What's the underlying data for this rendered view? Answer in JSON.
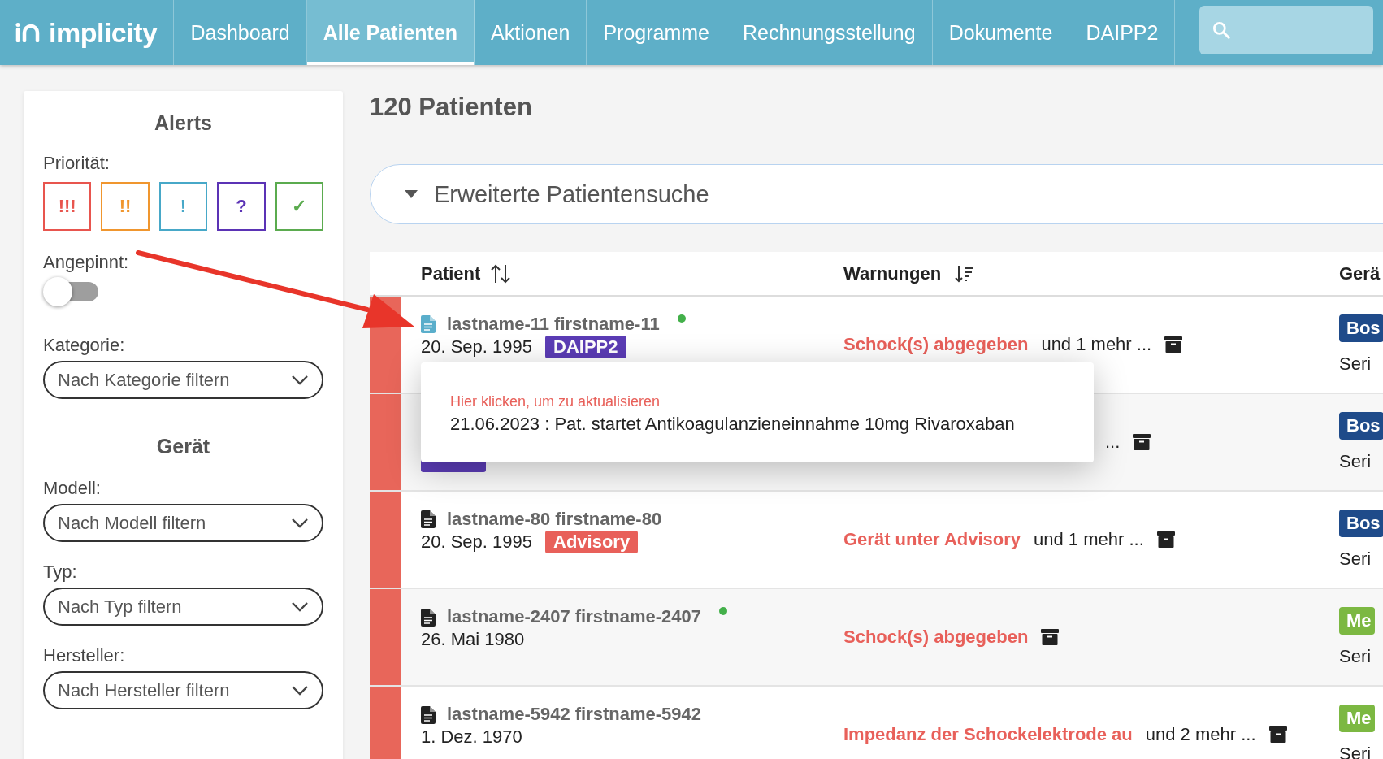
{
  "nav": {
    "logo": "implicity",
    "tabs": [
      {
        "label": "Dashboard",
        "selected": false
      },
      {
        "label": "Alle Patienten",
        "selected": true
      },
      {
        "label": "Aktionen",
        "selected": false
      },
      {
        "label": "Programme",
        "selected": false
      },
      {
        "label": "Rechnungsstellung",
        "selected": false
      },
      {
        "label": "Dokumente",
        "selected": false
      },
      {
        "label": "DAIPP2",
        "selected": false
      }
    ]
  },
  "filters": {
    "alerts_title": "Alerts",
    "priority_label": "Priorität:",
    "priorities": [
      {
        "symbol": "!!!",
        "color": "#e8554e",
        "selected": false
      },
      {
        "symbol": "!!",
        "color": "#f0962e",
        "selected": false
      },
      {
        "symbol": "!",
        "color": "#47a8c8",
        "selected": false
      },
      {
        "symbol": "?",
        "color": "#5b33b5",
        "selected": false
      },
      {
        "symbol": "✓",
        "color": "#5bab4f",
        "selected": false
      }
    ],
    "pinned_label": "Angepinnt:",
    "pinned": false,
    "category": {
      "label": "Kategorie:",
      "placeholder": "Nach Kategorie filtern"
    },
    "device_title": "Gerät",
    "device_filters": [
      {
        "label": "Modell:",
        "placeholder": "Nach Modell filtern"
      },
      {
        "label": "Typ:",
        "placeholder": "Nach Typ filtern"
      },
      {
        "label": "Hersteller:",
        "placeholder": "Nach Hersteller filtern"
      }
    ]
  },
  "main": {
    "title": "120 Patienten",
    "advanced_search": {
      "label": "Erweiterte Patientensuche",
      "expanded": false
    },
    "table": {
      "columns": [
        {
          "label": "Patient",
          "kind": "sortable"
        },
        {
          "label": "Warnungen",
          "kind": "sorted"
        },
        {
          "label": "Gerä",
          "kind": "plain"
        }
      ],
      "rows": [
        {
          "color": "#e8665a",
          "name": "lastname-11 firstname-11",
          "note_active": true,
          "online": true,
          "date": "20. Sep. 1995",
          "tag": {
            "label": "DAIPP2",
            "color": "#5b3cb5"
          },
          "warning": "Schock(s) abgegeben",
          "more": "und 1 mehr ...",
          "device_tag": {
            "label": "Bos",
            "color": "#1f4b8a"
          },
          "device_line": "Seri"
        },
        {
          "color": "#e8665a",
          "tag": {
            "color": "#5b3cb5"
          },
          "more": "...",
          "device_tag": {
            "label": "Bos",
            "color": "#1f4b8a"
          },
          "device_line": "Seri"
        },
        {
          "color": "#e8665a",
          "name": "lastname-80 firstname-80",
          "note_active": false,
          "online": false,
          "date": "20. Sep. 1995",
          "tag": {
            "label": "Advisory",
            "color": "#e8605a"
          },
          "warning": "Gerät unter Advisory",
          "more": "und 1 mehr ...",
          "device_tag": {
            "label": "Bos",
            "color": "#1f4b8a"
          },
          "device_line": "Seri"
        },
        {
          "color": "#e8665a",
          "name": "lastname-2407 firstname-2407",
          "note_active": false,
          "online": true,
          "date": "26. Mai 1980",
          "warning": "Schock(s) abgegeben",
          "device_tag": {
            "label": "Me",
            "color": "#7cb842"
          },
          "device_line": "Seri"
        },
        {
          "color": "#e8665a",
          "name": "lastname-5942 firstname-5942",
          "note_active": false,
          "online": false,
          "date": "1. Dez. 1970",
          "warning": "Impedanz der Schockelektrode au",
          "more": "und 2 mehr ...",
          "device_tag": {
            "label": "Me",
            "color": "#7cb842"
          },
          "device_line": "Seri"
        }
      ]
    },
    "tooltip": {
      "hint": "Hier klicken, um zu aktualisieren",
      "note": "21.06.2023 : Pat. startet Antikoagulanzieneinnahme 10mg Rivaroxaban"
    }
  }
}
